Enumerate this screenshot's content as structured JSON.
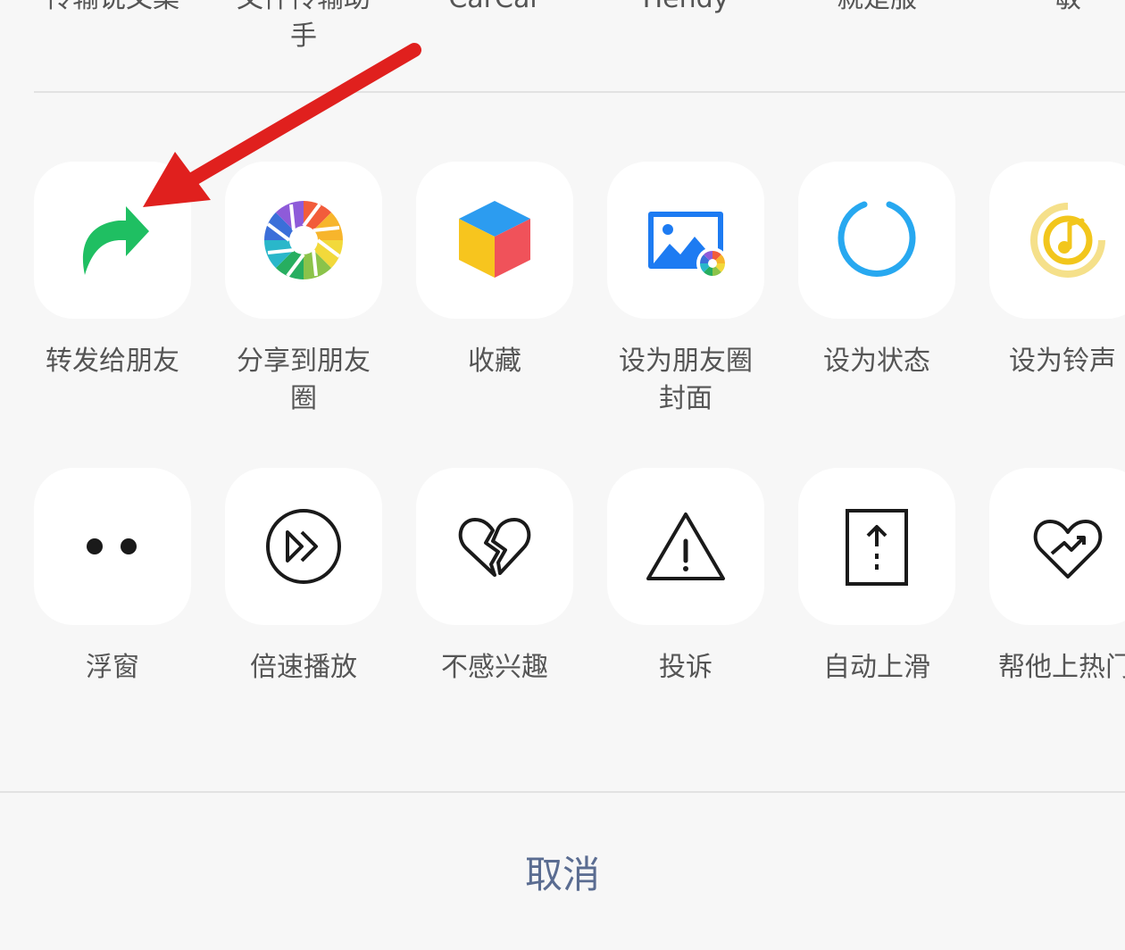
{
  "top_row": {
    "items": [
      {
        "label": "传输说文案"
      },
      {
        "label": "文件传输助\n手"
      },
      {
        "label": "CarCar"
      },
      {
        "label": "Hendy"
      },
      {
        "label": "就是服"
      },
      {
        "label": "敏"
      }
    ]
  },
  "share_row": {
    "items": [
      {
        "label": "转发给朋友",
        "icon": "forward-icon"
      },
      {
        "label": "分享到朋友\n圈",
        "icon": "moments-icon"
      },
      {
        "label": "收藏",
        "icon": "favorites-cube-icon"
      },
      {
        "label": "设为朋友圈\n封面",
        "icon": "moments-cover-icon"
      },
      {
        "label": "设为状态",
        "icon": "status-ring-icon"
      },
      {
        "label": "设为铃声",
        "icon": "ringtone-icon"
      }
    ]
  },
  "action_row": {
    "items": [
      {
        "label": "浮窗",
        "icon": "float-window-dots-icon"
      },
      {
        "label": "倍速播放",
        "icon": "playback-speed-icon"
      },
      {
        "label": "不感兴趣",
        "icon": "broken-heart-icon"
      },
      {
        "label": "投诉",
        "icon": "warning-icon"
      },
      {
        "label": "自动上滑",
        "icon": "auto-scroll-up-icon"
      },
      {
        "label": "帮他上热门",
        "icon": "promote-heart-icon"
      }
    ]
  },
  "cancel_label": "取消",
  "colors": {
    "background": "#f7f7f7",
    "tile": "#ffffff",
    "label": "#555555",
    "cancel": "#5a6c91",
    "forward_green": "#1fbf62",
    "annotation_red": "#e0201e"
  }
}
